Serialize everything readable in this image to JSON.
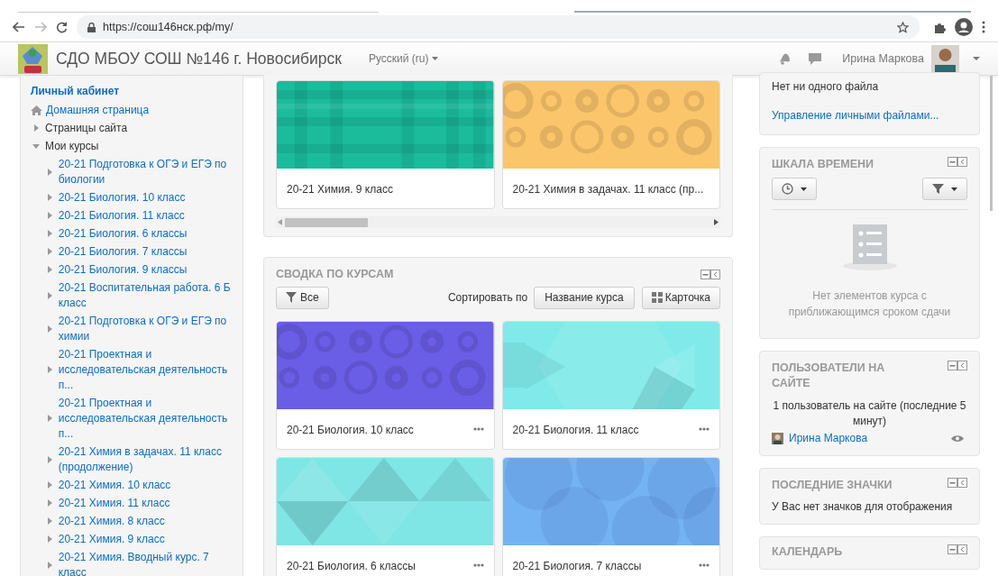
{
  "browser": {
    "url": "https://сош146нск.рф/my/",
    "forward_disabled": true
  },
  "navbar": {
    "site_name": "СДО МБОУ СОШ №146 г. Новосибирск",
    "language": "Русский (ru)",
    "user_name": "Ирина Маркова"
  },
  "sidebar": {
    "header": "Личный кабинет",
    "items": [
      {
        "label": "Домашняя страница",
        "kind": "home"
      },
      {
        "label": "Страницы сайта",
        "kind": "node",
        "expanded": false
      },
      {
        "label": "Мои курсы",
        "kind": "node",
        "expanded": true,
        "children": [
          {
            "label": "20-21 Подготовка к ОГЭ и ЕГЭ по биологии",
            "expanded": false
          },
          {
            "label": "20-21 Биология. 10 класс",
            "expanded": false
          },
          {
            "label": "20-21 Биология. 11 класс",
            "expanded": false
          },
          {
            "label": "20-21 Биология. 6 классы",
            "expanded": false
          },
          {
            "label": "20-21 Биология. 7 классы",
            "expanded": false
          },
          {
            "label": "20-21 Биология. 9 классы",
            "expanded": false
          },
          {
            "label": "20-21 Воспитательная работа. 6 Б класс",
            "expanded": false
          },
          {
            "label": "20-21 Подготовка к ОГЭ и ЕГЭ по химии",
            "expanded": false
          },
          {
            "label": "20-21 Проектная и исследовательская деятельность п...",
            "expanded": false
          },
          {
            "label": "20-21 Проектная и исследовательская деятельность п...",
            "expanded": false
          },
          {
            "label": "20-21 Химия в задачах. 11 класс (продолжение)",
            "expanded": false
          },
          {
            "label": "20-21 Химия. 10 класс",
            "expanded": false
          },
          {
            "label": "20-21 Химия. 11 класс",
            "expanded": false
          },
          {
            "label": "20-21 Химия. 8 класс",
            "expanded": false
          },
          {
            "label": "20-21 Химия. 9 класс",
            "expanded": false
          },
          {
            "label": "20-21 Химия. Вводный курс. 7 класс",
            "expanded": false
          }
        ]
      }
    ]
  },
  "recent_courses": {
    "cards": [
      {
        "title": "20-21 Химия. 9 класс",
        "kind": "plaid",
        "color": "#1abc9c"
      },
      {
        "title": "20-21 Химия в задачах. 11 класс (пр...",
        "kind": "circles",
        "color": "#fbc56b"
      }
    ]
  },
  "course_overview": {
    "title": "СВОДКА ПО КУРСАМ",
    "filter": "Все",
    "sort_label": "Сортировать по",
    "sort_button": "Название курса",
    "view_button": "Карточка",
    "cards": [
      {
        "title": "20-21 Биология. 10 класс",
        "kind": "circles",
        "color": "#6a5de6"
      },
      {
        "title": "20-21 Биология. 11 класс",
        "kind": "hexagons",
        "color": "#80eaea"
      },
      {
        "title": "20-21 Биология. 6 классы",
        "kind": "triangles",
        "color": "#80e5e5"
      },
      {
        "title": "20-21 Биология. 7 классы",
        "kind": "bubbles",
        "color": "#74b3f3"
      }
    ]
  },
  "blocks": [
    {
      "kind": "files",
      "empty_text": "Нет ни одного файла",
      "link": "Управление личными файлами..."
    },
    {
      "kind": "timeline",
      "title": "ШКАЛА ВРЕМЕНИ",
      "empty_text": "Нет элементов курса с приближающимся сроком сдачи"
    },
    {
      "kind": "online_users",
      "title": "ПОЛЬЗОВАТЕЛИ НА САЙТЕ",
      "summary": "1 пользователь на сайте (последние 5 минут)",
      "users": [
        "Ирина Маркова"
      ]
    },
    {
      "kind": "badges",
      "title": "ПОСЛЕДНИЕ ЗНАЧКИ",
      "empty_text": "У Вас нет значков для отображения"
    },
    {
      "kind": "calendar",
      "title": "КАЛЕНДАРЬ"
    }
  ]
}
